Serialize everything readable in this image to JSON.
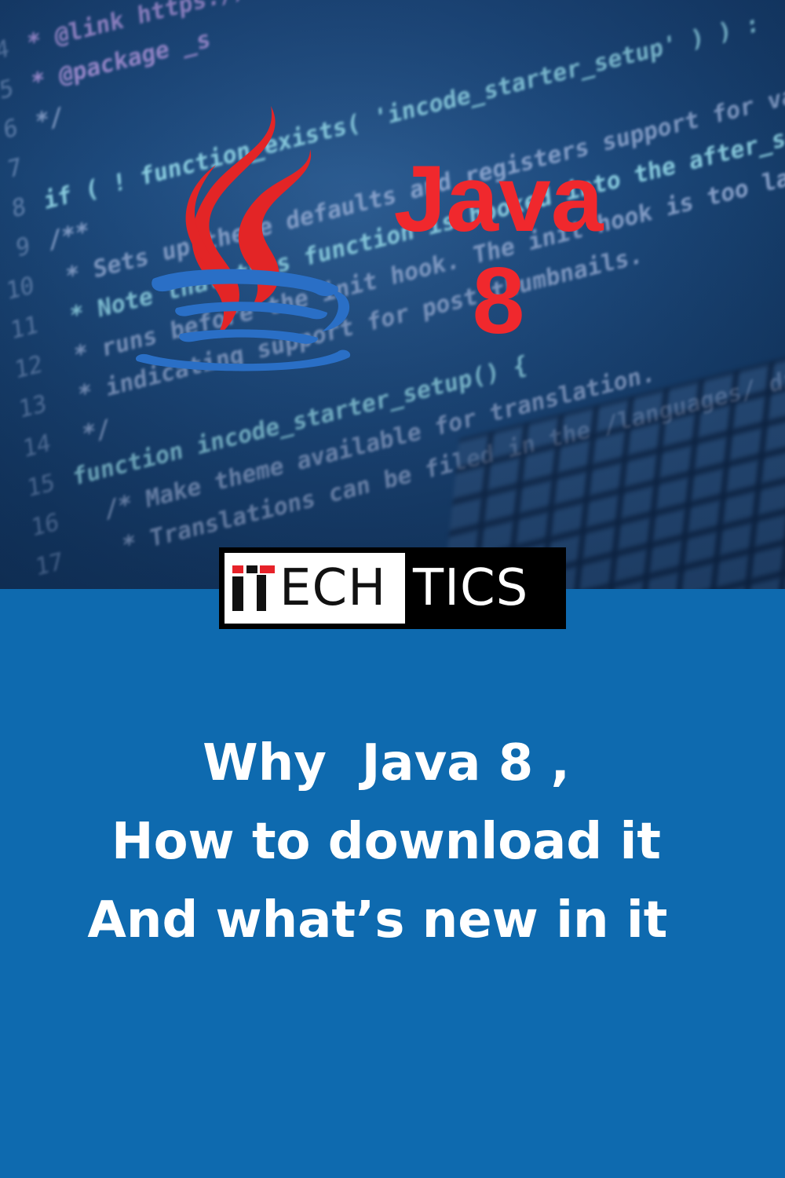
{
  "hero": {
    "title_line1": "Java",
    "title_line2": "8",
    "code_lines": [
      {
        "n": "4",
        "text": "* @link https://developer.wordpress.org"
      },
      {
        "n": "5",
        "text": "* @package _s"
      },
      {
        "n": "6",
        "text": "*/"
      },
      {
        "n": "7",
        "text": ""
      },
      {
        "n": "8",
        "text": "if ( ! function_exists( 'incode_starter_setup' ) ) :"
      },
      {
        "n": "9",
        "text": "/**"
      },
      {
        "n": "10",
        "text": " * Sets up theme defaults and registers support for various"
      },
      {
        "n": "11",
        "text": " * Note that this function is hooked into the after_setup_theme"
      },
      {
        "n": "12",
        "text": " * runs before the init hook. The init hook is too late for some"
      },
      {
        "n": "13",
        "text": " * indicating support for post thumbnails."
      },
      {
        "n": "14",
        "text": " */"
      },
      {
        "n": "15",
        "text": "function incode_starter_setup() {"
      },
      {
        "n": "16",
        "text": "  /* Make theme available for translation."
      },
      {
        "n": "17",
        "text": "   * Translations can be filed in the /languages/ directory."
      }
    ],
    "colors": {
      "title": "#f0282d",
      "logo_steam": "#e32526",
      "logo_cup": "#2a6fc6"
    }
  },
  "brand": {
    "dark_part": "ECH",
    "light_part": "TICS",
    "accent": "#e62229"
  },
  "headline": {
    "line1": "Why  Java 8 ,",
    "line2": "How to download it",
    "line3": "And what’s new in it "
  },
  "colors": {
    "bottom_panel": "#0e6aaf",
    "headline_text": "#ffffff"
  },
  "icons": {
    "java": "java-cup-logo"
  }
}
